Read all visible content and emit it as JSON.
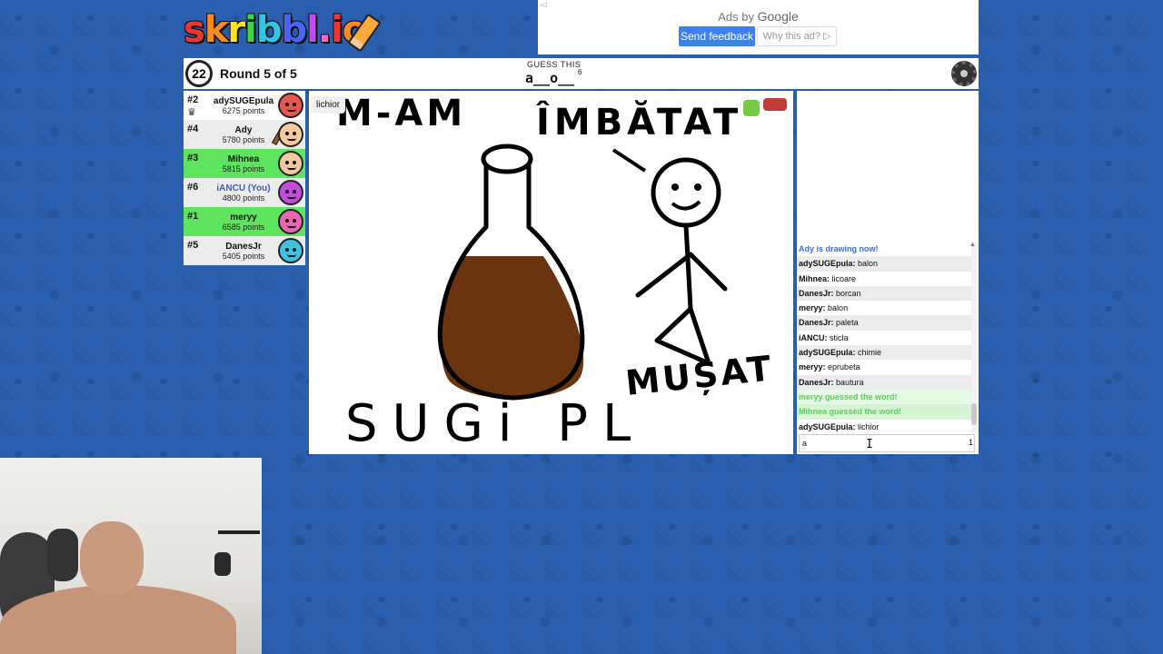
{
  "logo": {
    "text": "skribbl.io"
  },
  "ad": {
    "ads_by": "Ads by",
    "google": "Google",
    "send_feedback": "Send feedback",
    "why_this_ad": "Why this ad? ▷"
  },
  "header": {
    "timer": "22",
    "round": "Round 5 of 5",
    "guess_label": "GUESS THIS",
    "word_hint": "a__o__",
    "word_length": "6"
  },
  "players": [
    {
      "rank": "#2",
      "name": "adySUGEpula",
      "points": "6275 points",
      "color": "#e8574f",
      "status": "normal"
    },
    {
      "rank": "#4",
      "name": "Ady",
      "points": "5780 points",
      "color": "#f3c99f",
      "status": "drawing"
    },
    {
      "rank": "#3",
      "name": "Mihnea",
      "points": "5815 points",
      "color": "#f3c99f",
      "status": "guessed"
    },
    {
      "rank": "#6",
      "name": "iANCU (You)",
      "points": "4800 points",
      "color": "#c04cd8",
      "status": "you"
    },
    {
      "rank": "#1",
      "name": "meryy",
      "points": "6585 points",
      "color": "#e866b0",
      "status": "guessed"
    },
    {
      "rank": "#5",
      "name": "DanesJr",
      "points": "5405 points",
      "color": "#3cc3e0",
      "status": "normal"
    }
  ],
  "canvas": {
    "guess_bubble": "lichior",
    "text_top_left": "M-AM",
    "text_top_right": "ÎMBĂTAT",
    "text_bottom_left": "SUGi PL",
    "text_bottom_right": "MUȘAT"
  },
  "chat": {
    "messages": [
      {
        "type": "system-blue",
        "author": "",
        "text": "Ady is drawing now!"
      },
      {
        "type": "chat",
        "author": "adySUGEpula:",
        "text": "balon"
      },
      {
        "type": "chat",
        "author": "Mihnea:",
        "text": "licoare"
      },
      {
        "type": "chat",
        "author": "DanesJr:",
        "text": "borcan"
      },
      {
        "type": "chat",
        "author": "meryy:",
        "text": "balon"
      },
      {
        "type": "chat",
        "author": "DanesJr:",
        "text": "paleta"
      },
      {
        "type": "chat",
        "author": "iANCU:",
        "text": "sticla"
      },
      {
        "type": "chat",
        "author": "adySUGEpula:",
        "text": "chimie"
      },
      {
        "type": "chat",
        "author": "meryy:",
        "text": "eprubeta"
      },
      {
        "type": "chat",
        "author": "DanesJr:",
        "text": "bautura"
      },
      {
        "type": "system-green",
        "author": "",
        "text": "meryy guessed the word!"
      },
      {
        "type": "system-green",
        "author": "",
        "text": "Mihnea guessed the word!"
      },
      {
        "type": "chat",
        "author": "adySUGEpula:",
        "text": "lichior"
      }
    ],
    "input_value": "a",
    "char_count": "1"
  },
  "colors": {
    "background": "#2a5fb0",
    "guessed_row": "#5ee45e",
    "system_blue": "#3c6ad6",
    "system_green": "#55d455",
    "send_feedback_button": "#3b82f0",
    "bottle_liquid": "#6b3410"
  }
}
